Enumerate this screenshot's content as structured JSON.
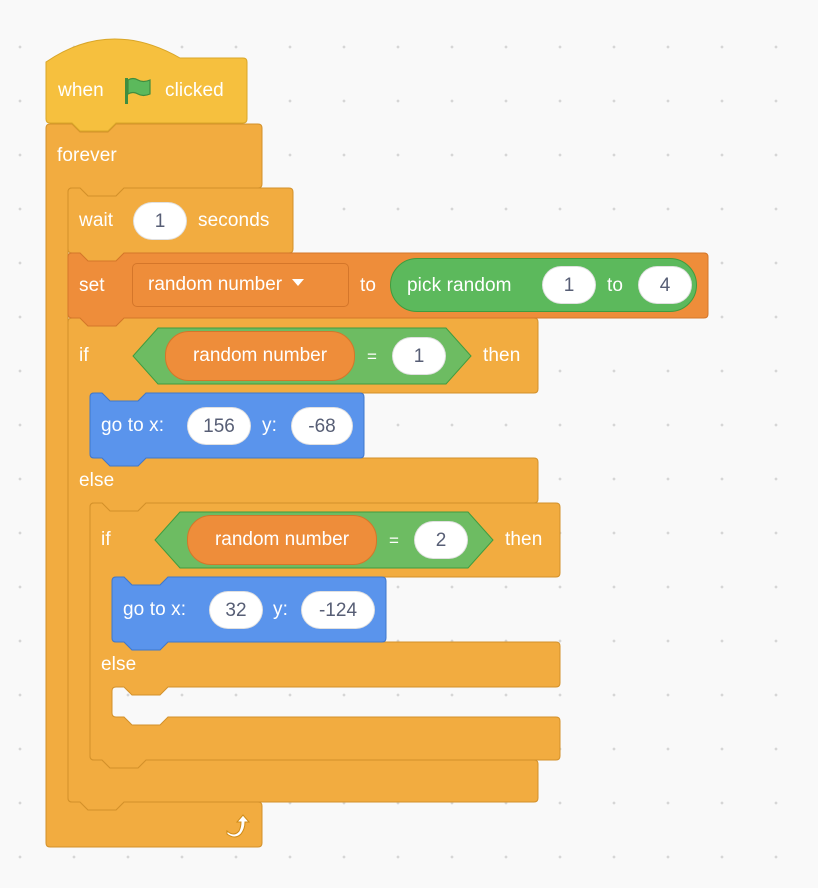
{
  "colors": {
    "events": "#f6c03e",
    "events_border": "#d9a628",
    "control": "#f2ac40",
    "control_border": "#d3912a",
    "variables": "#ee8d3a",
    "variables_border": "#d4762a",
    "operators": "#6dbc62",
    "operators_border": "#3f9c3f",
    "motion": "#5a94ec",
    "motion_border": "#3f77cc",
    "field_text": "#575e75",
    "canvas_bg": "#f9f9f9"
  },
  "script": {
    "hat": {
      "label_before": "when",
      "icon": "green-flag-icon",
      "label_after": "clicked"
    },
    "forever": {
      "label": "forever",
      "icon": "loop-arrow-icon"
    },
    "wait": {
      "label_before": "wait",
      "value": "1",
      "label_after": "seconds"
    },
    "set": {
      "label": "set",
      "variable": "random number",
      "to_label": "to",
      "pick_random": {
        "label": "pick random",
        "from": "1",
        "to_label": "to",
        "to": "4"
      }
    },
    "if1": {
      "if_label": "if",
      "condition": {
        "variable": "random number",
        "operator": "=",
        "value": "1"
      },
      "then_label": "then",
      "goto": {
        "label": "go to x:",
        "x": "156",
        "y_label": "y:",
        "y": "-68"
      },
      "else_label": "else"
    },
    "if2": {
      "if_label": "if",
      "condition": {
        "variable": "random number",
        "operator": "=",
        "value": "2"
      },
      "then_label": "then",
      "goto": {
        "label": "go to x:",
        "x": "32",
        "y_label": "y:",
        "y": "-124"
      },
      "else_label": "else"
    }
  }
}
